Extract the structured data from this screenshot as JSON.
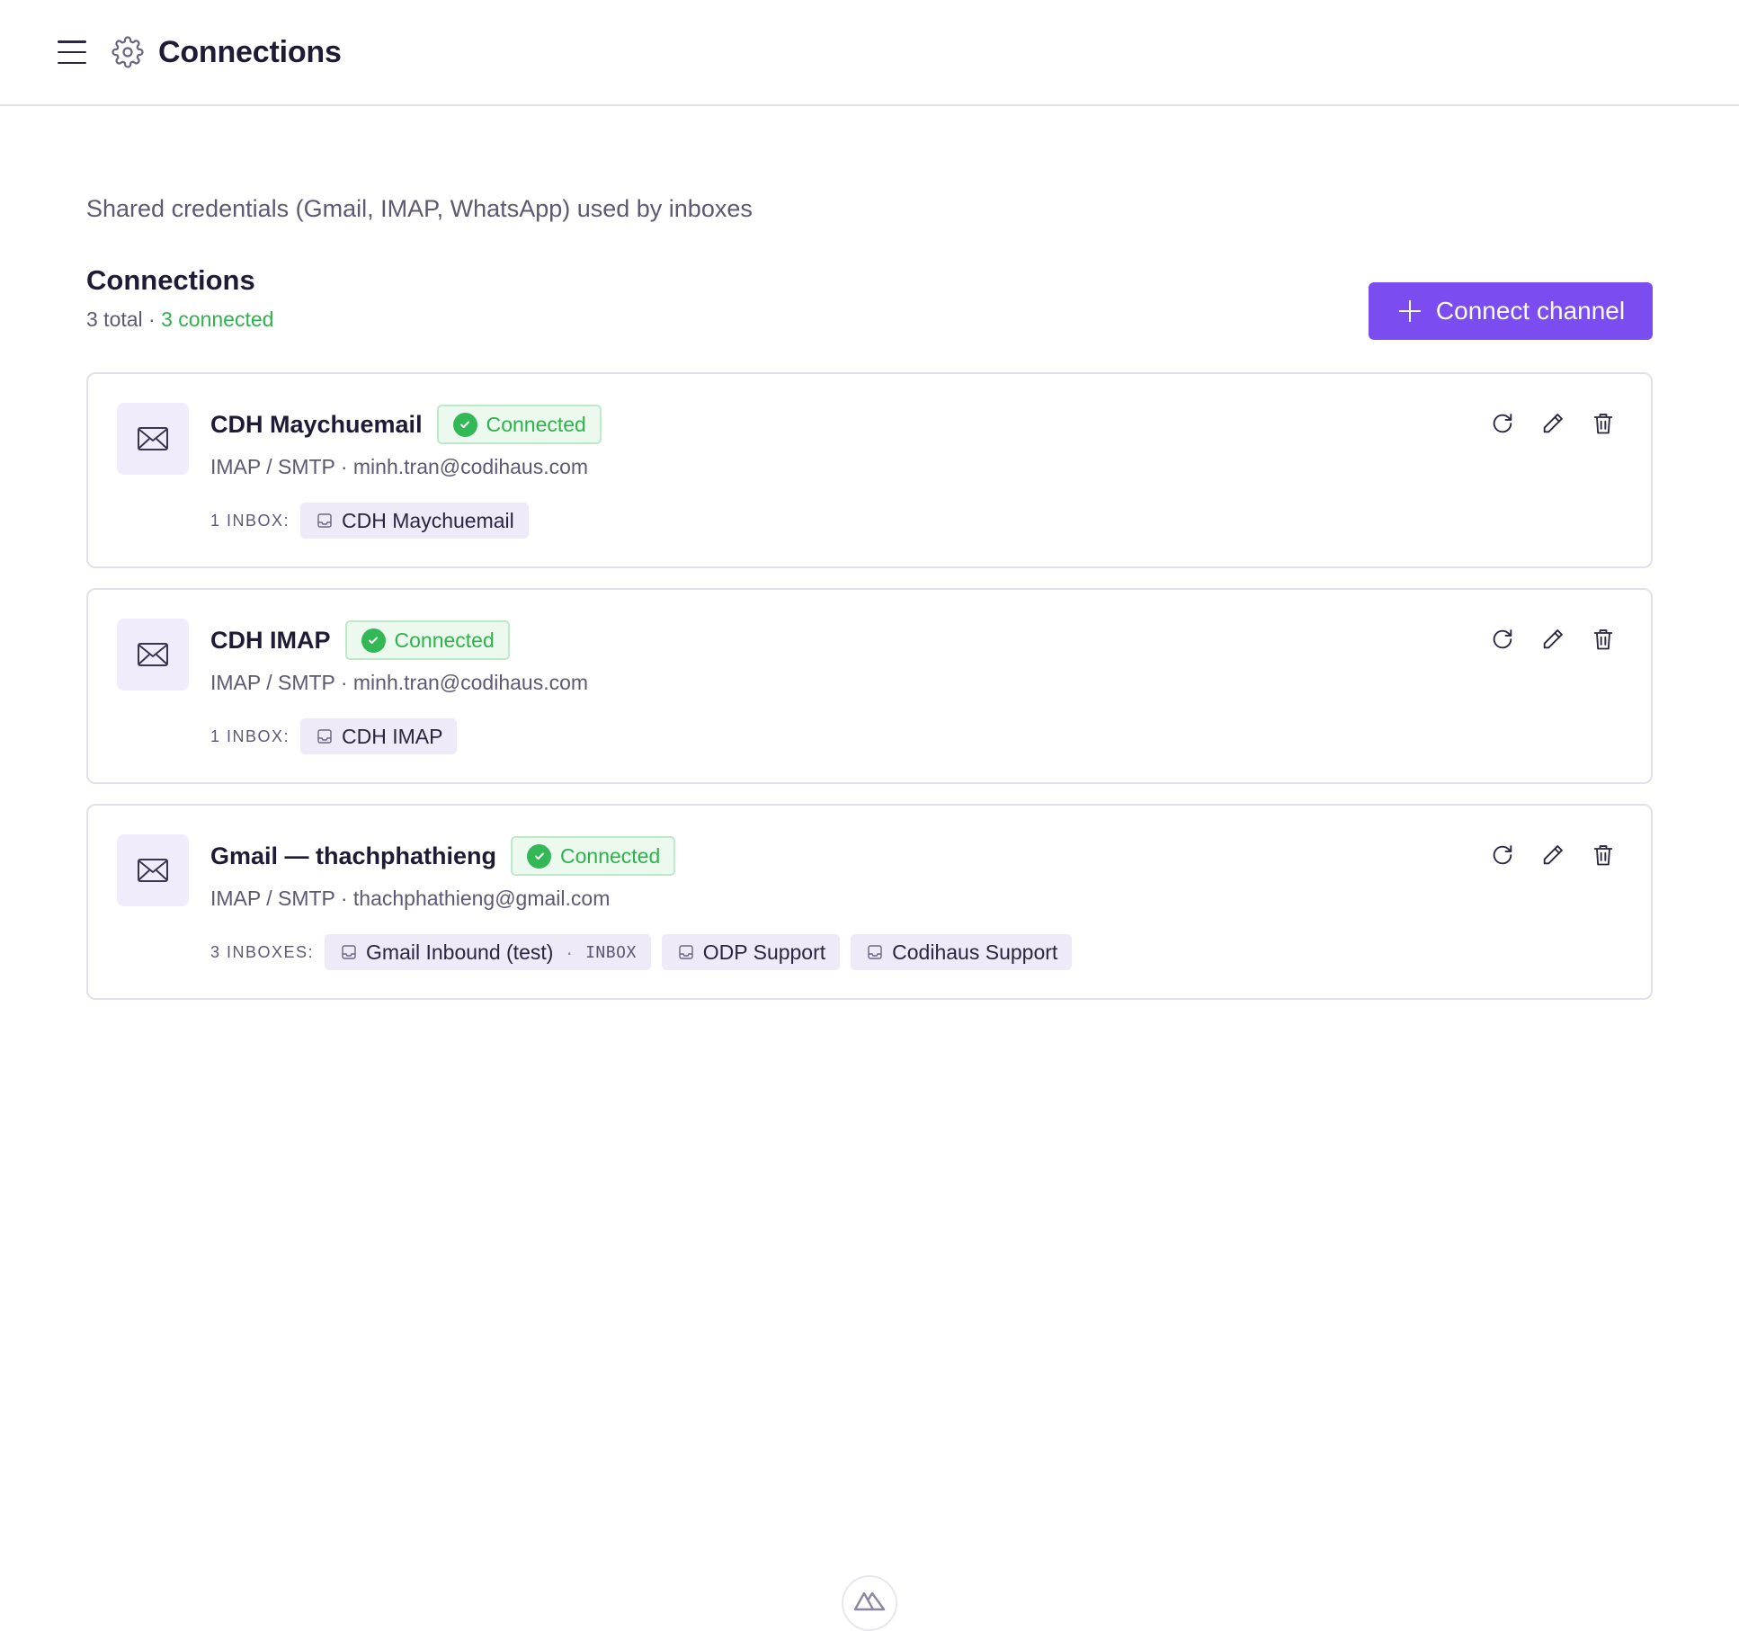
{
  "header": {
    "title": "Connections"
  },
  "page": {
    "subtitle": "Shared credentials (Gmail, IMAP, WhatsApp) used by inboxes",
    "section_title": "Connections",
    "total_text": "3 total",
    "separator": "·",
    "connected_text": "3 connected",
    "connect_button": "Connect channel"
  },
  "colors": {
    "accent": "#7b4cf0",
    "success": "#2fb24c",
    "icon_bg": "#f1ecfb"
  },
  "connections": [
    {
      "name": "CDH Maychuemail",
      "status": "Connected",
      "meta": "IMAP / SMTP · minh.tran@codihaus.com",
      "inbox_label": "1 INBOX:",
      "inboxes": [
        {
          "name": "CDH Maychuemail"
        }
      ]
    },
    {
      "name": "CDH IMAP",
      "status": "Connected",
      "meta": "IMAP / SMTP · minh.tran@codihaus.com",
      "inbox_label": "1 INBOX:",
      "inboxes": [
        {
          "name": "CDH IMAP"
        }
      ]
    },
    {
      "name": "Gmail — thachphathieng",
      "status": "Connected",
      "meta": "IMAP / SMTP · thachphathieng@gmail.com",
      "inbox_label": "3 INBOXES:",
      "inboxes": [
        {
          "name": "Gmail Inbound (test)",
          "folder": "INBOX"
        },
        {
          "name": "ODP Support"
        },
        {
          "name": "Codihaus Support"
        }
      ]
    }
  ],
  "icons": {
    "menu": "menu-icon",
    "settings": "gear-icon",
    "add": "plus-icon",
    "channel": "mail-icon",
    "status": "check-circle-icon",
    "inbox": "inbox-icon",
    "refresh": "refresh-icon",
    "edit": "pencil-icon",
    "delete": "trash-icon",
    "devtools": "nuxt-logo-icon"
  }
}
